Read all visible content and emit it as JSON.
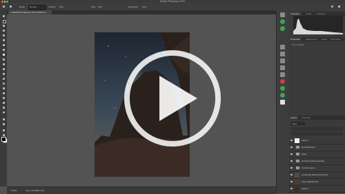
{
  "app": {
    "title": "Adobe Photoshop 2021"
  },
  "options_bar": {
    "mode_label": "Mode:",
    "mode_value": "Normal",
    "opacity_label": "Opacity:",
    "opacity_value": "61%",
    "flow_label": "Flow:",
    "flow_value": "90%",
    "smoothing_label": "Smoothing:",
    "smoothing_value": "10%"
  },
  "document_tab": {
    "label": "● 1BGJ8274.NEF @ 8.33% (RGB/16*)"
  },
  "status_bar": {
    "zoom": "8.33%",
    "doc_info": "Doc: 244.6M/1.71G"
  },
  "panels": {
    "top_tabs": [
      "Histogram",
      "Cards",
      "Navigator"
    ],
    "properties_tabs": [
      "Properties",
      "Adjustments",
      "Styles",
      "Information"
    ],
    "properties_text": "No properties",
    "layers_tabs": [
      "Layers",
      "Channels"
    ],
    "layers_kind": "Kind"
  },
  "layers": [
    {
      "name": "Layer 5",
      "kind": "pixel"
    },
    {
      "name": "Normal Photos",
      "kind": "folder"
    },
    {
      "name": "Stars",
      "kind": "folder"
    },
    {
      "name": "Hot Removal & Linework",
      "kind": "folder"
    },
    {
      "name": "Curves Layers",
      "kind": "folder"
    },
    {
      "name": "Luminosity Mask Dynamic AI",
      "kind": "pixel"
    },
    {
      "name": "Layer Adjustments",
      "kind": "pixel"
    },
    {
      "name": "Layer 0",
      "kind": "pixel"
    }
  ],
  "colors": {
    "accent": "#1473e6",
    "overlay": "#ffffff"
  },
  "icons": {
    "play": "play-icon",
    "eye": "eye-icon",
    "folder": "folder-icon"
  }
}
